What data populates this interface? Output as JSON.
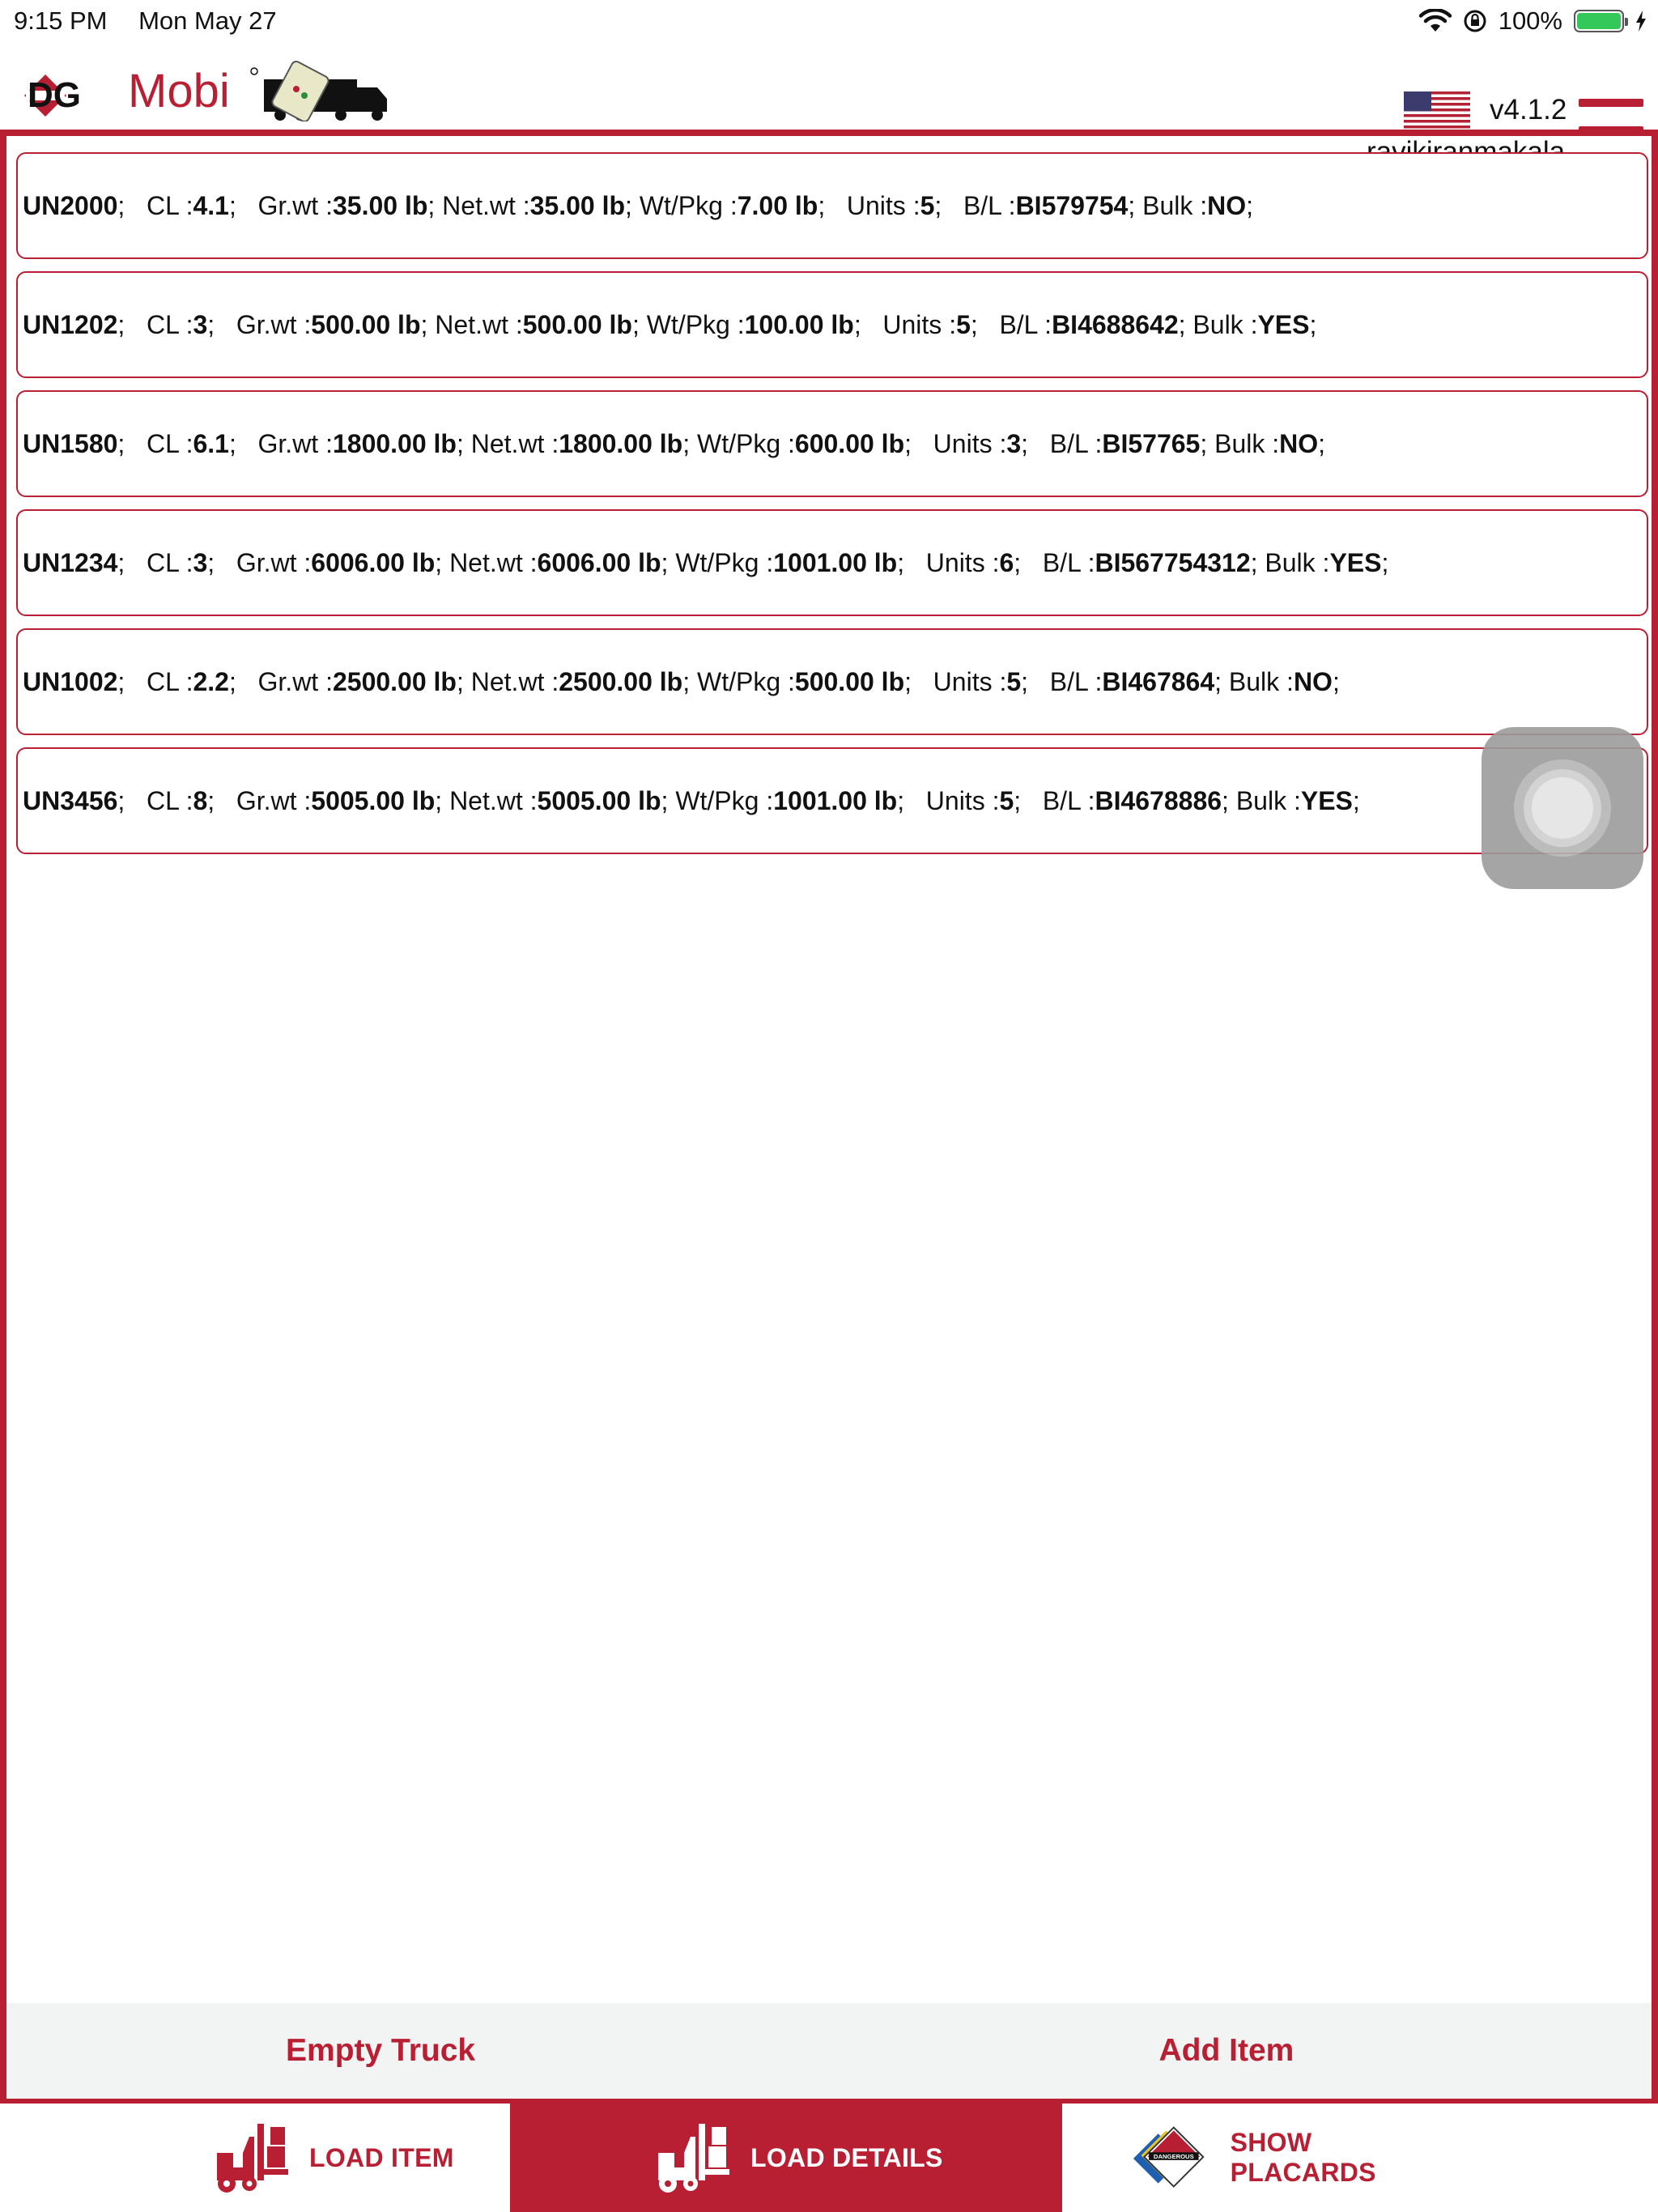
{
  "status_bar": {
    "time": "9:15 PM",
    "date": "Mon May 27",
    "battery": "100%"
  },
  "header": {
    "logo_text_dg": "DG",
    "logo_text_mobi": "Mobi",
    "version": "v4.1.2",
    "username": "ravikiranmakala"
  },
  "items": [
    {
      "un": "UN2000",
      "cl": "4.1",
      "grwt": "35.00 lb",
      "netwt": "35.00 lb",
      "wtpkg": "7.00 lb",
      "units": "5",
      "bl": "BI579754",
      "bulk": "NO"
    },
    {
      "un": "UN1202",
      "cl": "3",
      "grwt": "500.00 lb",
      "netwt": "500.00 lb",
      "wtpkg": "100.00 lb",
      "units": "5",
      "bl": "BI4688642",
      "bulk": "YES"
    },
    {
      "un": "UN1580",
      "cl": "6.1",
      "grwt": "1800.00 lb",
      "netwt": "1800.00 lb",
      "wtpkg": "600.00 lb",
      "units": "3",
      "bl": "BI57765",
      "bulk": "NO"
    },
    {
      "un": "UN1234",
      "cl": "3",
      "grwt": "6006.00 lb",
      "netwt": "6006.00 lb",
      "wtpkg": "1001.00 lb",
      "units": "6",
      "bl": "BI567754312",
      "bulk": "YES"
    },
    {
      "un": "UN1002",
      "cl": "2.2",
      "grwt": "2500.00 lb",
      "netwt": "2500.00 lb",
      "wtpkg": "500.00 lb",
      "units": "5",
      "bl": "BI467864",
      "bulk": "NO"
    },
    {
      "un": "UN3456",
      "cl": "8",
      "grwt": "5005.00 lb",
      "netwt": "5005.00 lb",
      "wtpkg": "1001.00 lb",
      "units": "5",
      "bl": "BI4678886",
      "bulk": "YES"
    }
  ],
  "field_labels": {
    "cl": "CL : ",
    "grwt": "Gr.wt : ",
    "netwt": "Net.wt : ",
    "wtpkg": "Wt/Pkg : ",
    "units": "Units : ",
    "bl": "B/L : ",
    "bulk": "Bulk : "
  },
  "actions": {
    "empty_truck": "Empty Truck",
    "add_item": "Add Item"
  },
  "tabs": [
    {
      "label": "LOAD ITEM",
      "icon": "forklift-icon",
      "active": false
    },
    {
      "label": "LOAD DETAILS",
      "icon": "forklift-icon",
      "active": true
    },
    {
      "label": "SHOW PLACARDS",
      "icon": "placard-icon",
      "active": false
    }
  ],
  "colors": {
    "brand_red": "#b81f33",
    "action_bar_bg": "#f2f3f3",
    "battery_green": "#34c759"
  }
}
